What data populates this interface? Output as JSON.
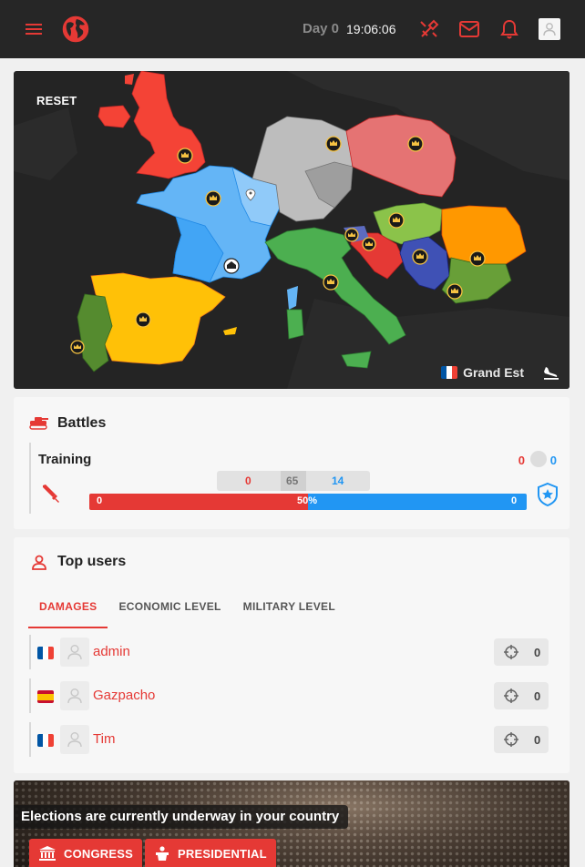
{
  "topbar": {
    "day_label": "Day 0",
    "time": "19:06:06",
    "icons": [
      "menu-icon",
      "globe-logo-icon",
      "battle-icon",
      "mail-icon",
      "bell-icon",
      "user-icon"
    ],
    "accent": "#e53935"
  },
  "map": {
    "reset_label": "RESET",
    "current_region": "Grand Est",
    "current_country_flag": "france",
    "travel_icon": "plane-landing-icon",
    "colors": {
      "uk": "#f44336",
      "france": "#64b5f6",
      "france_dark": "#42a5f5",
      "spain": "#ffc107",
      "portugal": "#558b2f",
      "italy": "#4caf50",
      "germany": "#bdbdbd",
      "poland": "#e57373",
      "romania": "#ff9800",
      "hungary": "#8bc34a",
      "serbia": "#3f51b5",
      "croatia": "#e53935"
    }
  },
  "battles": {
    "title": "Battles",
    "icon": "tank-icon",
    "items": [
      {
        "name": "Training",
        "attacker_score": "0",
        "defender_score": "0",
        "attacker_damage": "0",
        "round": "65",
        "defender_damage": "14",
        "attacker_bar_label": "0",
        "percent_label": "50%",
        "defender_bar_label": "0",
        "attacker_share": 0.5
      }
    ]
  },
  "top_users": {
    "title": "Top users",
    "icon": "user-outline-icon",
    "tabs": [
      "DAMAGES",
      "ECONOMIC LEVEL",
      "MILITARY LEVEL"
    ],
    "active_tab": 0,
    "users": [
      {
        "name": "admin",
        "flag": "france",
        "value": "0"
      },
      {
        "name": "Gazpacho",
        "flag": "spain",
        "value": "0"
      },
      {
        "name": "Tim",
        "flag": "france",
        "value": "0"
      }
    ]
  },
  "elections": {
    "text": "Elections are currently underway in your country",
    "congress_label": "CONGRESS",
    "presidential_label": "PRESIDENTIAL"
  }
}
